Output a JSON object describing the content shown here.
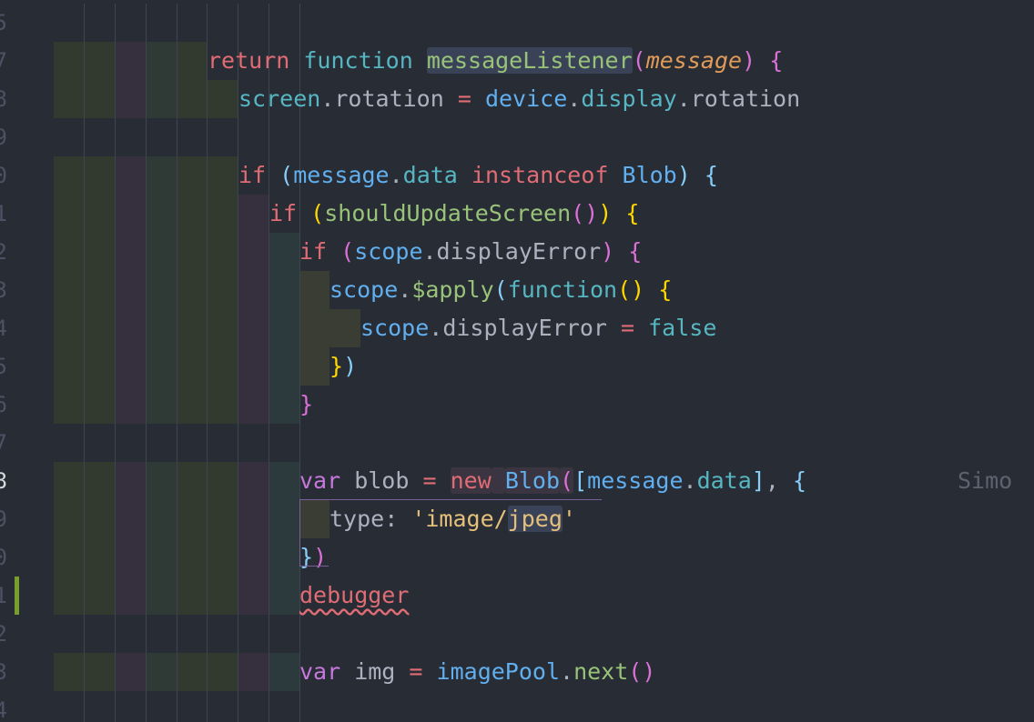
{
  "editor": {
    "blame_annotation": "Simo",
    "lines": [
      {
        "num": "5",
        "text": ""
      },
      {
        "num": "7",
        "text": "return function messageListener(message) {"
      },
      {
        "num": "8",
        "text": "screen.rotation = device.display.rotation"
      },
      {
        "num": "9",
        "text": ""
      },
      {
        "num": "0",
        "text": "if (message.data instanceof Blob) {"
      },
      {
        "num": "1",
        "text": "if (shouldUpdateScreen()) {"
      },
      {
        "num": "2",
        "text": "if (scope.displayError) {"
      },
      {
        "num": "3",
        "text": "scope.$apply(function() {"
      },
      {
        "num": "4",
        "text": "scope.displayError = false"
      },
      {
        "num": "5",
        "text": "})"
      },
      {
        "num": "6",
        "text": "}"
      },
      {
        "num": "7",
        "text": ""
      },
      {
        "num": "8",
        "text": "var blob = new Blob([message.data], {"
      },
      {
        "num": "9",
        "text": "type: 'image/jpeg'"
      },
      {
        "num": "0",
        "text": "})"
      },
      {
        "num": "1",
        "text": "debugger"
      },
      {
        "num": "2",
        "text": ""
      },
      {
        "num": "3",
        "text": "var img = imagePool.next()"
      },
      {
        "num": "4",
        "text": ""
      }
    ],
    "current_line_index": 12,
    "git_modified_line_index": 15
  },
  "colors": {
    "background": "#282c34",
    "indent_level_1": "#323a2f",
    "indent_level_2": "#2f3a36",
    "indent_level_3": "#352f3e",
    "indent_level_4": "#2c3a3e",
    "indent_level_5": "#3a3d33",
    "git_modified": "#7a9e2b"
  },
  "tokens": {
    "l1": [
      [
        "c-kw",
        "return"
      ],
      [
        "c-plain",
        " "
      ],
      [
        "c-fnkw",
        "function"
      ],
      [
        "c-plain",
        " "
      ],
      [
        "c-fn hl-sel",
        "messageListener"
      ],
      [
        "c-b2",
        "("
      ],
      [
        "c-param",
        "message"
      ],
      [
        "c-b2",
        ")"
      ],
      [
        "c-plain",
        " "
      ],
      [
        "c-b2",
        "{"
      ]
    ],
    "l2": [
      [
        "c-var",
        "screen"
      ],
      [
        "c-plain",
        ".rotation "
      ],
      [
        "c-op",
        "="
      ],
      [
        "c-plain",
        " "
      ],
      [
        "c-ty",
        "device"
      ],
      [
        "c-plain",
        "."
      ],
      [
        "c-prop",
        "display"
      ],
      [
        "c-plain",
        ".rotation"
      ]
    ],
    "l4": [
      [
        "c-kw",
        "if"
      ],
      [
        "c-plain",
        " "
      ],
      [
        "c-b3",
        "("
      ],
      [
        "c-ty",
        "message"
      ],
      [
        "c-plain",
        "."
      ],
      [
        "c-prop",
        "data"
      ],
      [
        "c-plain",
        " "
      ],
      [
        "c-kw",
        "instanceof"
      ],
      [
        "c-plain",
        " "
      ],
      [
        "c-ty",
        "Blob"
      ],
      [
        "c-b3",
        ")"
      ],
      [
        "c-plain",
        " "
      ],
      [
        "c-b3",
        "{"
      ]
    ],
    "l5": [
      [
        "c-kw",
        "if"
      ],
      [
        "c-plain",
        " "
      ],
      [
        "c-b1",
        "("
      ],
      [
        "c-fn",
        "shouldUpdateScreen"
      ],
      [
        "c-b2",
        "()"
      ],
      [
        "c-b1",
        ")"
      ],
      [
        "c-plain",
        " "
      ],
      [
        "c-b1",
        "{"
      ]
    ],
    "l6": [
      [
        "c-kw",
        "if"
      ],
      [
        "c-plain",
        " "
      ],
      [
        "c-b2",
        "("
      ],
      [
        "c-ty",
        "scope"
      ],
      [
        "c-plain",
        ".displayError"
      ],
      [
        "c-b2",
        ")"
      ],
      [
        "c-plain",
        " "
      ],
      [
        "c-b2",
        "{"
      ]
    ],
    "l7": [
      [
        "c-ty",
        "scope"
      ],
      [
        "c-plain",
        "."
      ],
      [
        "c-fn",
        "$apply"
      ],
      [
        "c-b3",
        "("
      ],
      [
        "c-fnkw",
        "function"
      ],
      [
        "c-b1",
        "()"
      ],
      [
        "c-plain",
        " "
      ],
      [
        "c-b1",
        "{"
      ]
    ],
    "l8": [
      [
        "c-ty",
        "scope"
      ],
      [
        "c-plain",
        ".displayError "
      ],
      [
        "c-op",
        "="
      ],
      [
        "c-plain",
        " "
      ],
      [
        "c-num",
        "false"
      ]
    ],
    "l9": [
      [
        "c-b1",
        "}"
      ],
      [
        "c-b3",
        ")"
      ]
    ],
    "l10": [
      [
        "c-b2",
        "}"
      ]
    ],
    "l12": [
      [
        "c-kw2",
        "var"
      ],
      [
        "c-plain",
        " blob "
      ],
      [
        "c-op",
        "="
      ],
      [
        "c-plain",
        " "
      ],
      [
        "c-kw hl-new",
        "new"
      ],
      [
        "c-plain hl-new",
        " "
      ],
      [
        "c-ty hl-new",
        "Blob"
      ],
      [
        "c-b2 hl-new",
        "("
      ],
      [
        "c-b3",
        "["
      ],
      [
        "c-ty",
        "message"
      ],
      [
        "c-plain",
        "."
      ],
      [
        "c-prop",
        "data"
      ],
      [
        "c-b3",
        "]"
      ],
      [
        "c-plain",
        ", "
      ],
      [
        "c-b3",
        "{"
      ]
    ],
    "l13": [
      [
        "c-plain",
        "type: "
      ],
      [
        "c-str",
        "'image/"
      ],
      [
        "c-str hl-sel",
        "jpeg"
      ],
      [
        "c-str",
        "'"
      ]
    ],
    "l14": [
      [
        "c-b3",
        "}"
      ],
      [
        "c-b2",
        ")"
      ]
    ],
    "l15": [
      [
        "c-kw squiggle",
        "debugger"
      ]
    ],
    "l17": [
      [
        "c-kw2",
        "var"
      ],
      [
        "c-plain",
        " img "
      ],
      [
        "c-op",
        "="
      ],
      [
        "c-plain",
        " "
      ],
      [
        "c-ty",
        "imagePool"
      ],
      [
        "c-plain",
        "."
      ],
      [
        "c-fn",
        "next"
      ],
      [
        "c-b2",
        "()"
      ]
    ]
  }
}
